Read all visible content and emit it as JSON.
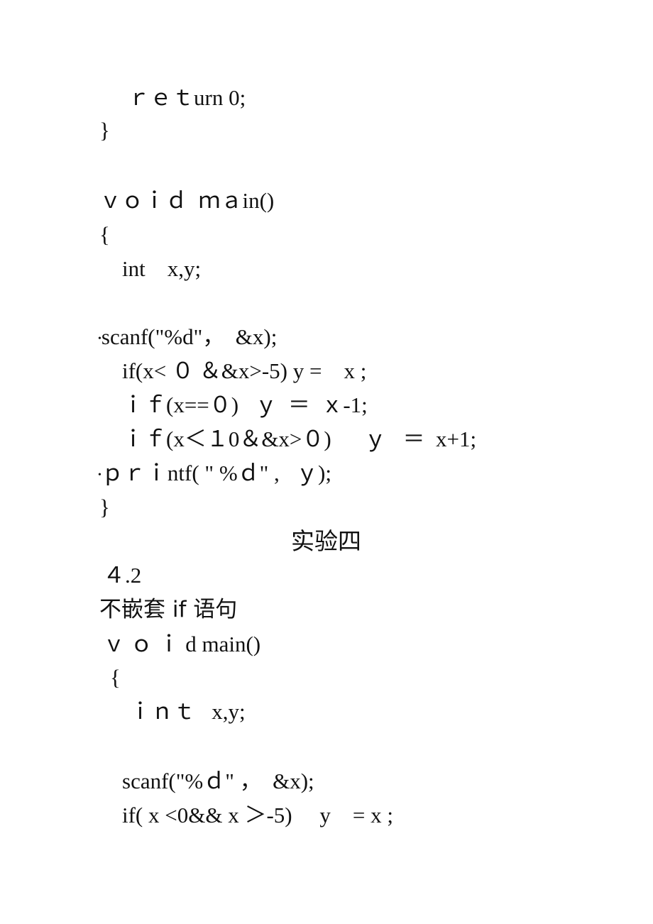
{
  "document": {
    "block1": {
      "return_line": "ｒｅｔurn 0;",
      "close_brace": "}",
      "main_signature": "ｖｏｉｄ  ｍａin()",
      "open_brace": "{",
      "decl": "int    x,y;",
      "bullet_glyph": "•",
      "scanf_line": "scanf(\"%d\"，  &x);",
      "if1": "if(x< ０ ＆&x>-5) y =    x ;",
      "if2": "ｉｆ(x==０)   ｙ  ＝  ｘ-1;",
      "if3": "ｉｆ(x＜１0＆&x>０)      ｙ   ＝  x+1;",
      "printf_line": "ｐｒｉntf( \" %ｄ\" ,   ｙ);",
      "close_brace2": "}"
    },
    "section_title": "实验四",
    "section_number": "４.2",
    "subsection_title": "不嵌套 if 语句",
    "block2": {
      "main_signature": "ｖ ｏ ｉ d main()",
      "open_brace": "{",
      "decl": "ｉｎｔ   x,y;",
      "scanf_line": "scanf(\"%ｄ\" ，  &x);",
      "if1": "if( x <0&& x ＞-5)     y    = x ;"
    }
  }
}
